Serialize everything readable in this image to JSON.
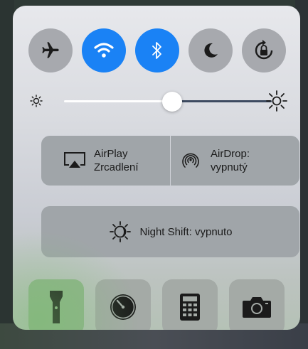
{
  "control_center": {
    "toggles": [
      {
        "icon": "airplane-icon",
        "state": "off"
      },
      {
        "icon": "wifi-icon",
        "state": "on"
      },
      {
        "icon": "bluetooth-icon",
        "state": "on"
      },
      {
        "icon": "moon-icon",
        "state": "off"
      },
      {
        "icon": "rotation-lock-icon",
        "state": "off"
      }
    ],
    "brightness": {
      "level": 0.53
    },
    "airplay": {
      "line1": "AirPlay",
      "line2": "Zrcadlení"
    },
    "airdrop": {
      "line1": "AirDrop:",
      "line2": "vypnutý"
    },
    "night_shift": {
      "label": "Night Shift: vypnuto"
    },
    "bottom_buttons": [
      {
        "icon": "flashlight-icon"
      },
      {
        "icon": "timer-icon"
      },
      {
        "icon": "calculator-icon"
      },
      {
        "icon": "camera-icon"
      }
    ],
    "colors": {
      "accent": "#1a82f5",
      "button": "#a0a5a9"
    }
  }
}
